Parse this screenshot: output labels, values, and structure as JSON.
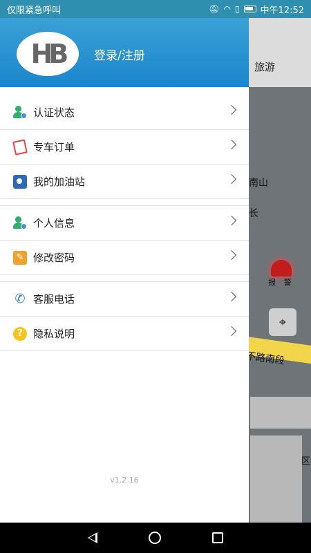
{
  "status_bar": {
    "carrier_text": "仅限紧急呼叫",
    "time": "中午12:52",
    "icons": [
      "mute-icon",
      "wifi-icon",
      "sim-alert-icon",
      "battery-icon"
    ]
  },
  "map": {
    "tab_label": "旅游",
    "place_label_1": "南山",
    "place_label_2": "长",
    "road_label": "不路南段",
    "alarm_label": "报 警",
    "right_edge_label": "区",
    "locate_icon": "crosshair-icon"
  },
  "drawer": {
    "login_label": "登录/注册",
    "logo_text": "HB",
    "sections": [
      [
        {
          "label": "认证状态",
          "icon": "verify-person-icon"
        },
        {
          "label": "专车订单",
          "icon": "order-icon"
        },
        {
          "label": "我的加油站",
          "icon": "gas-station-icon"
        }
      ],
      [
        {
          "label": "个人信息",
          "icon": "person-info-icon"
        },
        {
          "label": "修改密码",
          "icon": "edit-password-icon"
        }
      ],
      [
        {
          "label": "客服电话",
          "icon": "phone-icon"
        },
        {
          "label": "隐私说明",
          "icon": "help-icon"
        }
      ]
    ],
    "version": "v1.2.16"
  },
  "colors": {
    "header_blue": "#1a86cc",
    "statusbar_blue": "#2f8fb0",
    "green": "#2eaf6e",
    "alarm_red": "#c21c1c"
  }
}
